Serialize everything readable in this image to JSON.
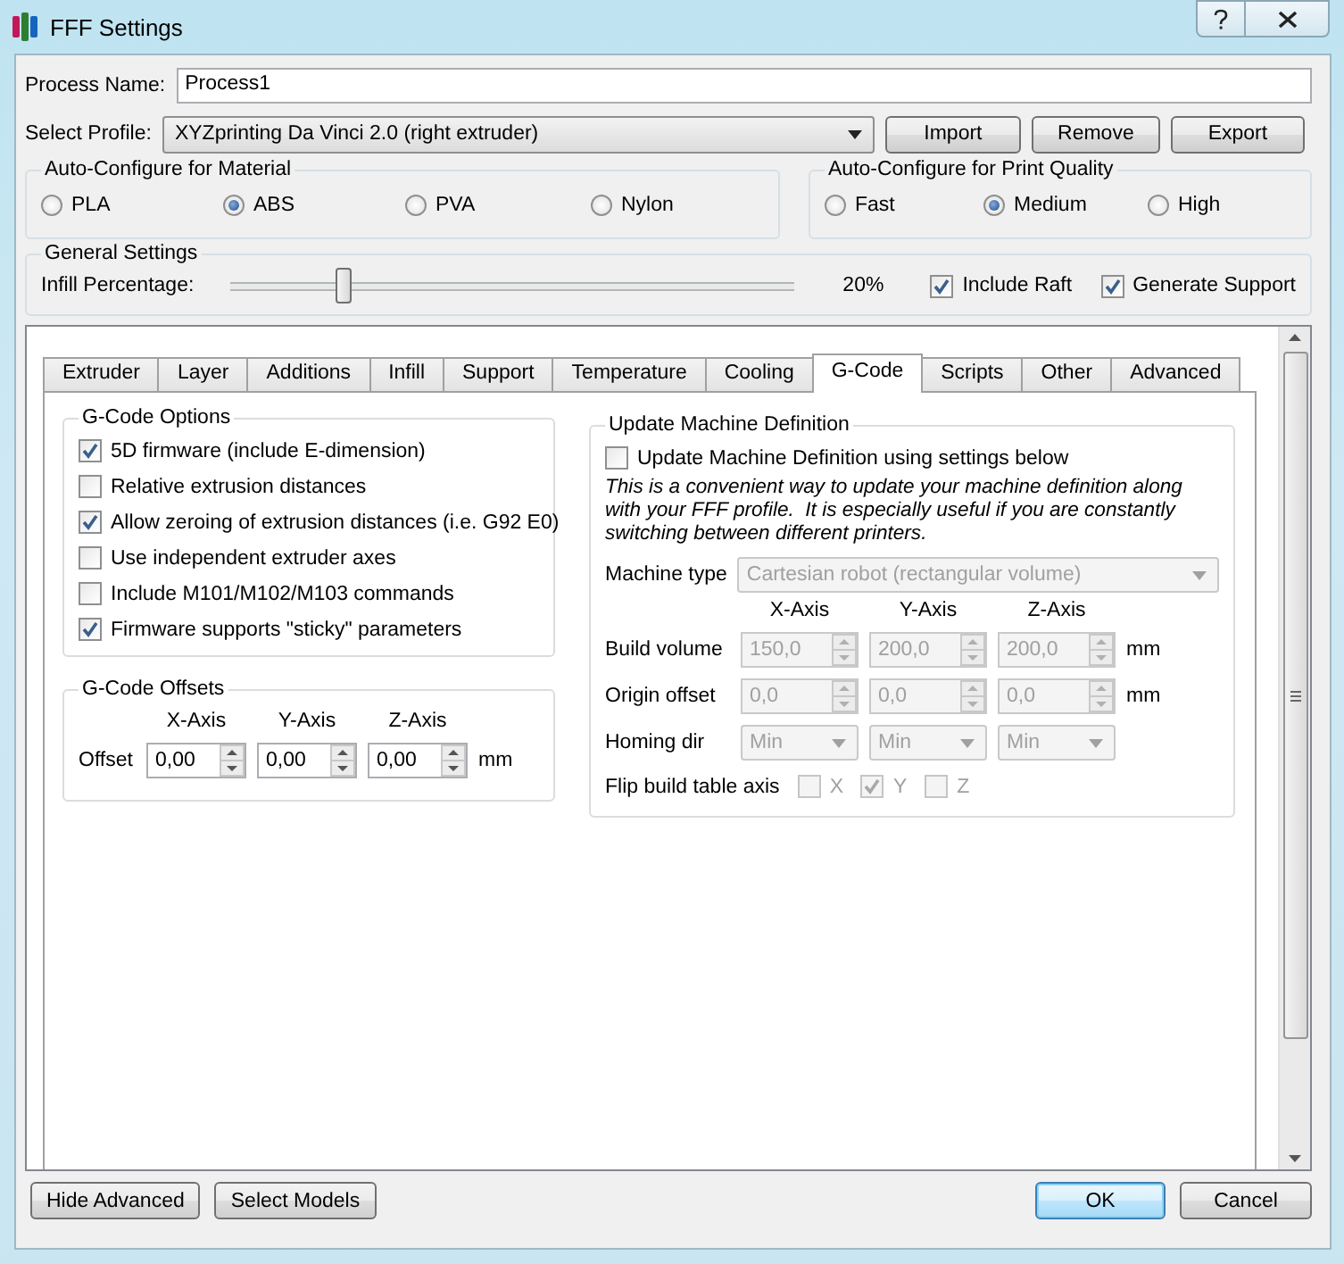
{
  "window": {
    "title": "FFF Settings"
  },
  "process_name": {
    "label": "Process Name:",
    "value": "Process1"
  },
  "profile": {
    "label": "Select Profile:",
    "value": "XYZprinting Da Vinci 2.0 (right extruder)",
    "buttons": [
      "Import",
      "Remove",
      "Export"
    ]
  },
  "material": {
    "title": "Auto-Configure for Material",
    "options": [
      {
        "label": "PLA",
        "selected": false
      },
      {
        "label": "ABS",
        "selected": true
      },
      {
        "label": "PVA",
        "selected": false
      },
      {
        "label": "Nylon",
        "selected": false
      }
    ]
  },
  "quality": {
    "title": "Auto-Configure for Print Quality",
    "options": [
      {
        "label": "Fast",
        "selected": false
      },
      {
        "label": "Medium",
        "selected": true
      },
      {
        "label": "High",
        "selected": false
      }
    ]
  },
  "general": {
    "title": "General Settings",
    "infill_label": "Infill Percentage:",
    "level": 0.2,
    "reading": "20%",
    "checks": [
      {
        "label": "Include Raft",
        "checked": true
      },
      {
        "label": "Generate Support",
        "checked": true
      }
    ]
  },
  "tabs": [
    {
      "label": "Extruder",
      "selected": false
    },
    {
      "label": "Layer",
      "selected": false
    },
    {
      "label": "Additions",
      "selected": false
    },
    {
      "label": "Infill",
      "selected": false
    },
    {
      "label": "Support",
      "selected": false
    },
    {
      "label": "Temperature",
      "selected": false
    },
    {
      "label": "Cooling",
      "selected": false
    },
    {
      "label": "G-Code",
      "selected": true
    },
    {
      "label": "Scripts",
      "selected": false
    },
    {
      "label": "Other",
      "selected": false
    },
    {
      "label": "Advanced",
      "selected": false
    }
  ],
  "gcode_options": {
    "title": "G-Code Options",
    "options": [
      {
        "label": "5D firmware (include E-dimension)",
        "checked": true
      },
      {
        "label": "Relative extrusion distances",
        "checked": false
      },
      {
        "label": "Allow zeroing of extrusion distances (i.e. G92 E0)",
        "checked": true
      },
      {
        "label": "Use independent extruder axes",
        "checked": false
      },
      {
        "label": "Include M101/M102/M103 commands",
        "checked": false
      },
      {
        "label": "Firmware supports \"sticky\" parameters",
        "checked": true
      }
    ]
  },
  "gcode_offsets": {
    "title": "G-Code Offsets",
    "axes": [
      "X-Axis",
      "Y-Axis",
      "Z-Axis"
    ],
    "row_label": "Offset",
    "values": [
      "0,00",
      "0,00",
      "0,00"
    ],
    "unit": "mm"
  },
  "machine": {
    "title": "Update Machine Definition",
    "update": {
      "label": "Update Machine Definition using settings below",
      "checked": false
    },
    "note": "This is a convenient way to update your machine definition along with your FFF profile.  It is especially useful if you are constantly switching between different printers.",
    "type_label": "Machine type",
    "type_value": "Cartesian robot (rectangular volume)",
    "axes": [
      "X-Axis",
      "Y-Axis",
      "Z-Axis"
    ],
    "rows": [
      {
        "kind": "spin",
        "label": "Build volume",
        "values": [
          "150,0",
          "200,0",
          "200,0"
        ],
        "unit": "mm"
      },
      {
        "kind": "spin",
        "label": "Origin offset",
        "values": [
          "0,0",
          "0,0",
          "0,0"
        ],
        "unit": "mm"
      },
      {
        "kind": "combo",
        "label": "Homing dir",
        "values": [
          "Min",
          "Min",
          "Min"
        ]
      }
    ],
    "flip": {
      "label": "Flip build table axis",
      "axes": [
        {
          "label": "X",
          "checked": false
        },
        {
          "label": "Y",
          "checked": true
        },
        {
          "label": "Z",
          "checked": false
        }
      ]
    }
  },
  "buttons_left": [
    "Hide Advanced",
    "Select Models"
  ],
  "buttons_right": [
    {
      "label": "OK",
      "default": true
    },
    {
      "label": "Cancel",
      "default": false
    }
  ]
}
